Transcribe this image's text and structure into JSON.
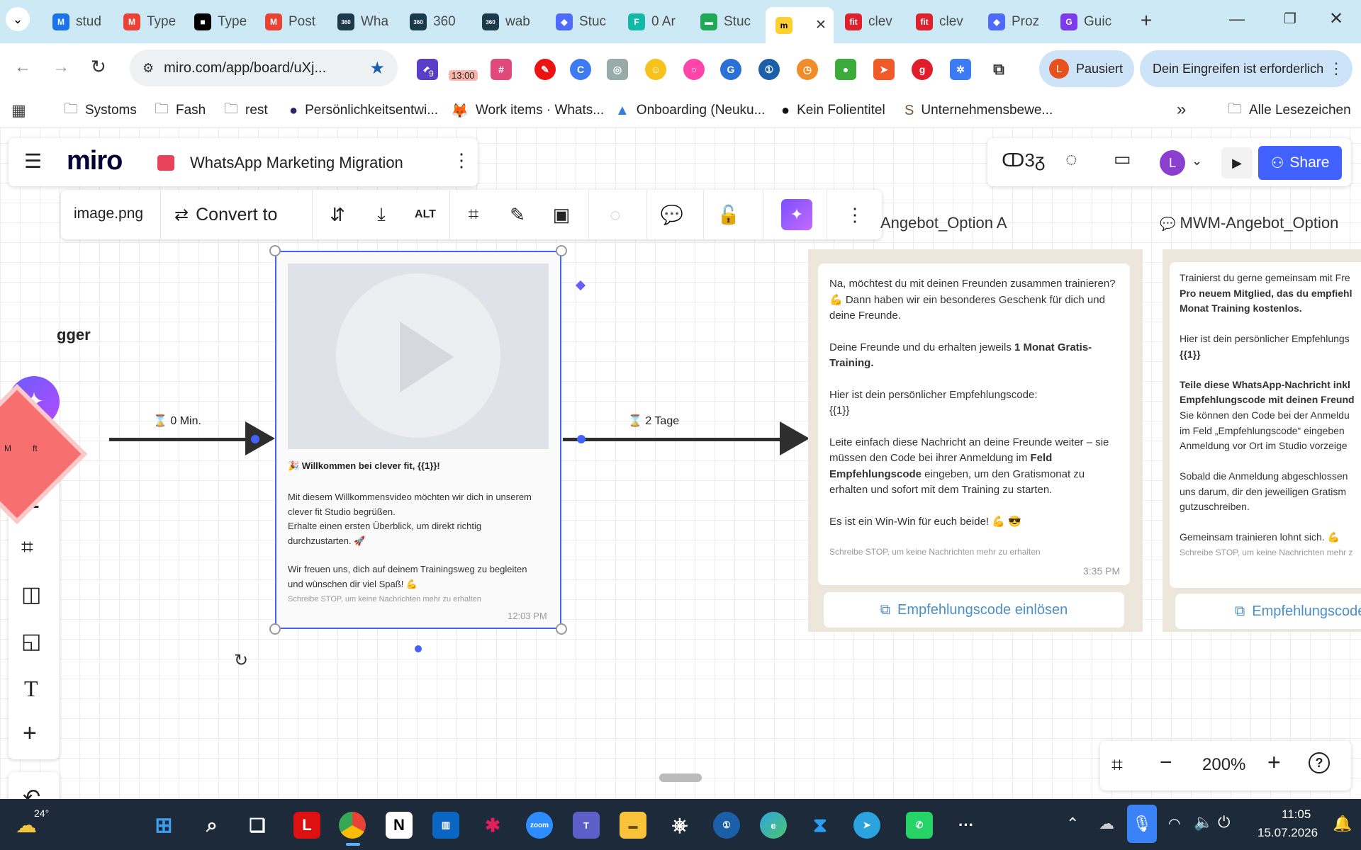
{
  "browser": {
    "tabs": [
      {
        "label": "stud",
        "color": "#1a73e8",
        "glyph": "M"
      },
      {
        "label": "Type",
        "color": "#ea4335",
        "glyph": "M"
      },
      {
        "label": "Type",
        "color": "#000000",
        "glyph": "■"
      },
      {
        "label": "Post",
        "color": "#ea4335",
        "glyph": "M"
      },
      {
        "label": "Wha",
        "color": "#1b3a4b",
        "glyph": "360"
      },
      {
        "label": "360",
        "color": "#1b3a4b",
        "glyph": "360"
      },
      {
        "label": "wab",
        "color": "#1b3a4b",
        "glyph": "360"
      },
      {
        "label": "Stuc",
        "color": "#4f6bff",
        "glyph": "◆"
      },
      {
        "label": "0 Ar",
        "color": "#14b8a6",
        "glyph": "F"
      },
      {
        "label": "Stuc",
        "color": "#1fa855",
        "glyph": "▬"
      },
      {
        "label": "",
        "color": "#ffd02f",
        "glyph": "m"
      },
      {
        "label": "clev",
        "color": "#e0202a",
        "glyph": "fit"
      },
      {
        "label": "clev",
        "color": "#e0202a",
        "glyph": "fit"
      },
      {
        "label": "Proz",
        "color": "#4f6bff",
        "glyph": "◆"
      },
      {
        "label": "Guic",
        "color": "#7c3aed",
        "glyph": "G"
      }
    ],
    "url": "miro.com/app/board/uXj...",
    "profile_initial": "L",
    "profile_status": "Pausiert",
    "intervention_banner": "Dein Eingreifen ist erforderlich",
    "calendar_badge": "13:00",
    "ext_badge": "9",
    "bookmarks": [
      {
        "label": "Systoms"
      },
      {
        "label": "Fash"
      },
      {
        "label": "rest"
      },
      {
        "label": "Persönlichkeitsentwi..."
      },
      {
        "label": "Work items · Whats..."
      },
      {
        "label": "Onboarding (Neuku..."
      },
      {
        "label": "Kein Folientitel"
      },
      {
        "label": "Unternehmensbewe..."
      }
    ],
    "all_bookmarks": "Alle Lesezeichen"
  },
  "miro": {
    "logo": "miro",
    "board_title": "WhatsApp Marketing Migration",
    "user_initial": "L",
    "share": "Share",
    "reactions_icon": "ↀ3ᵹ"
  },
  "context_toolbar": {
    "filename": "image.png",
    "convert_to": "Convert to",
    "alt": "ALT"
  },
  "board": {
    "trigger_label": "gger",
    "diamond_text": "M         ft",
    "connector1": "⌛ 0 Min.",
    "connector2": "⌛ 2 Tage",
    "frame_a_title": "Angebot_Option A",
    "frame_b_title": "MWM-Angebot_Option",
    "video_card": {
      "heading": "🎉 Willkommen bei clever fit, {{1}}!",
      "p1": "Mit diesem Willkommensvideo möchten wir dich in unserem clever fit Studio begrüßen.",
      "p2": "Erhalte einen ersten Überblick, um direkt richtig durchzustarten. 🚀",
      "p3": "Wir freuen uns, dich auf deinem Trainingsweg zu begleiten und wünschen dir viel Spaß! 💪",
      "footer": "Schreibe STOP, um keine Nachrichten mehr zu erhalten",
      "time": "12:03 PM"
    },
    "msg_a": {
      "p1": "Na, möchtest du mit deinen Freunden zusammen trainieren? 💪 Dann haben wir ein besonderes Geschenk für dich und deine Freunde.",
      "p2a": "Deine Freunde und du erhalten jeweils ",
      "p2b": "1 Monat Gratis-Training.",
      "p3a": "Hier ist dein persönlicher Empfehlungscode:",
      "p3b": "{{1}}",
      "p4a": "Leite einfach diese Nachricht an deine Freunde weiter – sie müssen den Code bei ihrer Anmeldung im ",
      "p4b": "Feld Empfehlungscode",
      "p4c": " eingeben, um den Gratismonat zu erhalten und sofort mit dem Training zu starten.",
      "p5": "Es ist ein Win-Win für euch beide! 💪 😎",
      "footer": "Schreibe STOP, um keine Nachrichten mehr zu erhalten",
      "time": "3:35 PM",
      "button": "Empfehlungscode einlösen"
    },
    "msg_b": {
      "l1": "Trainierst du gerne gemeinsam mit Fre",
      "l2": "Pro neuem Mitglied, das du empfiehl",
      "l3": "Monat Training kostenlos.",
      "l4": "Hier ist dein persönlicher Empfehlungs",
      "l5": "{{1}}",
      "l6": "Teile diese WhatsApp-Nachricht inkl",
      "l7": "Empfehlungscode mit deinen Freund",
      "l8": "Sie können den Code bei der Anmeldu",
      "l9": "im Feld „Empfehlungscode“ eingeben",
      "l10": "Anmeldung vor Ort im Studio vorzeige",
      "l11": "Sobald die Anmeldung abgeschlossen",
      "l12": "uns darum, dir den jeweiligen Gratism",
      "l13": "gutzuschreiben.",
      "l14": "Gemeinsam trainieren lohnt sich. 💪",
      "footer": "Schreibe STOP, um keine Nachrichten mehr z",
      "button": "Empfehlungscode"
    }
  },
  "zoom": "200%",
  "taskbar": {
    "weather_temp": "24°",
    "time": "11:05",
    "date": "15.07.2026"
  }
}
